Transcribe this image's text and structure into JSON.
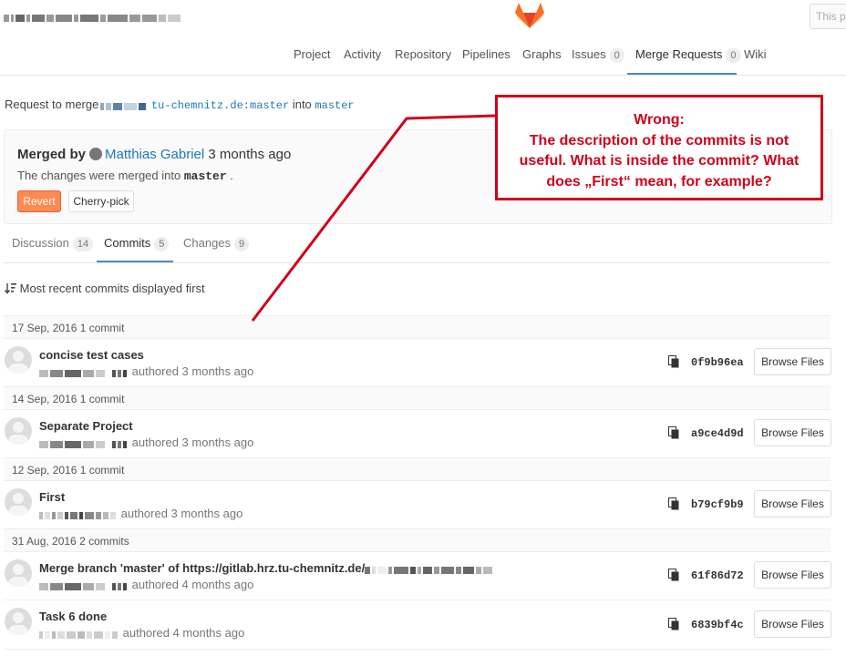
{
  "header": {
    "search_placeholder": "This pr",
    "logo_icon": "gitlab-fox-icon"
  },
  "nav": {
    "items": [
      {
        "label": "Project"
      },
      {
        "label": "Activity"
      },
      {
        "label": "Repository"
      },
      {
        "label": "Pipelines"
      },
      {
        "label": "Graphs"
      },
      {
        "label": "Issues",
        "count": "0"
      },
      {
        "label": "Merge Requests",
        "count": "0",
        "active": true
      },
      {
        "label": "Wiki"
      }
    ]
  },
  "request": {
    "prefix": "Request to merge",
    "source_branch": "tu-chemnitz.de:master",
    "middle": "into",
    "target_branch": "master"
  },
  "merged": {
    "prefix": "Merged by",
    "user": "Matthias Gabriel",
    "when": "3 months ago",
    "text_prefix": "The changes were merged into",
    "target": "master",
    "text_suffix": ".",
    "revert_label": "Revert",
    "cherry_pick_label": "Cherry-pick"
  },
  "tabs": [
    {
      "label": "Discussion",
      "count": "14"
    },
    {
      "label": "Commits",
      "count": "5",
      "active": true
    },
    {
      "label": "Changes",
      "count": "9"
    }
  ],
  "order_note": "Most recent commits displayed first",
  "commit_groups": [
    {
      "header": "17 Sep, 2016 1 commit",
      "commits": [
        {
          "title": "concise test cases",
          "meta": "authored 3 months ago",
          "sha": "0f9b96ea",
          "browse": "Browse Files"
        }
      ]
    },
    {
      "header": "14 Sep, 2016 1 commit",
      "commits": [
        {
          "title": "Separate Project",
          "meta": "authored 3 months ago",
          "sha": "a9ce4d9d",
          "browse": "Browse Files"
        }
      ]
    },
    {
      "header": "12 Sep, 2016 1 commit",
      "commits": [
        {
          "title": "First",
          "meta": "authored 3 months ago",
          "sha": "b79cf9b9",
          "browse": "Browse Files"
        }
      ]
    },
    {
      "header": "31 Aug, 2016 2 commits",
      "commits": [
        {
          "title": "Merge branch 'master' of https://gitlab.hrz.tu-chemnitz.de/",
          "meta": "authored 4 months ago",
          "sha": "61f86d72",
          "browse": "Browse Files"
        },
        {
          "title": "Task 6 done",
          "meta": "authored 4 months ago",
          "sha": "6839bf4c",
          "browse": "Browse Files"
        }
      ]
    }
  ],
  "annotation": {
    "lines": [
      "Wrong:",
      "The description of the commits is not",
      "useful. What is inside the commit? What",
      "does „First“ mean, for example?"
    ],
    "color": "#d0021b"
  }
}
